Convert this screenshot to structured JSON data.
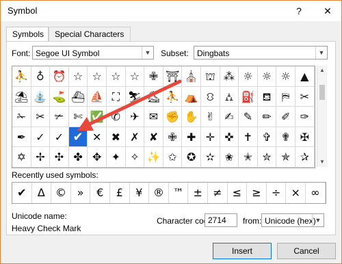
{
  "window": {
    "title": "Symbol",
    "help_label": "?",
    "close_label": "✕"
  },
  "tabs": [
    {
      "label": "Symbols",
      "active": true
    },
    {
      "label": "Special Characters",
      "active": false
    }
  ],
  "font": {
    "label": "Font:",
    "value": "Segoe UI Symbol"
  },
  "subset": {
    "label": "Subset:",
    "value": "Dingbats"
  },
  "symbol_grid": {
    "rows": [
      [
        "⛹",
        "♁",
        "⏰",
        "☆",
        "☆",
        "☆",
        "☆",
        "✙",
        "⛩",
        "⛪",
        "⛫",
        "⁂",
        "☼",
        "☼",
        "☼",
        "▲"
      ],
      [
        "⛱",
        "⛲",
        "⛳",
        "⛴",
        "⛵",
        "⛶",
        "⛷",
        "⛸",
        "⛹",
        "⛺",
        "⛻",
        "⛼",
        "⛽",
        "⛾",
        "⛿",
        "✂"
      ],
      [
        "✁",
        "✂",
        "✃",
        "✄",
        "✅",
        "✆",
        "✈",
        "✉",
        "✊",
        "✋",
        "✌",
        "✍",
        "✎",
        "✏",
        "✐",
        "✑"
      ],
      [
        "✒",
        "✓",
        "✓",
        "✔",
        "✕",
        "✖",
        "✗",
        "✘",
        "✙",
        "✚",
        "✛",
        "✜",
        "✝",
        "✞",
        "✟",
        "✠"
      ],
      [
        "✡",
        "✢",
        "✣",
        "✤",
        "✥",
        "✦",
        "✧",
        "✨",
        "✩",
        "✪",
        "✫",
        "✬",
        "✭",
        "✮",
        "✯",
        "✰"
      ]
    ],
    "selected": {
      "row": 3,
      "col": 3
    }
  },
  "recent": {
    "label": "Recently used symbols:",
    "symbols": [
      "✔",
      "Δ",
      "©",
      "»",
      "€",
      "£",
      "¥",
      "®",
      "™",
      "±",
      "≠",
      "≤",
      "≥",
      "÷",
      "×",
      "∞"
    ]
  },
  "unicode_name": {
    "label": "Unicode name:",
    "value": "Heavy Check Mark"
  },
  "character_code": {
    "label": "Character code:",
    "value": "2714"
  },
  "from": {
    "label": "from:",
    "value": "Unicode (hex)"
  },
  "buttons": {
    "insert": "Insert",
    "cancel": "Cancel"
  },
  "colors": {
    "selection": "#1e6ad8",
    "annotation_arrow": "#e8483b",
    "window_border": "#e0843a"
  }
}
